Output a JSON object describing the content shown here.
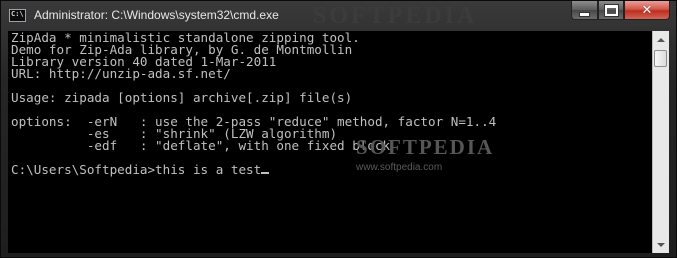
{
  "window": {
    "title": "Administrator: C:\\Windows\\system32\\cmd.exe",
    "icon_text": "C:\\",
    "watermark": "SOFTPEDIA",
    "buttons": {
      "minimize": "minimize-icon",
      "maximize": "maximize-icon",
      "close": "✕"
    }
  },
  "console": {
    "lines": [
      "ZipAda * minimalistic standalone zipping tool.",
      "Demo for Zip-Ada library, by G. de Montmollin",
      "Library version 40 dated 1-Mar-2011",
      "URL: http://unzip-ada.sf.net/",
      "",
      "Usage: zipada [options] archive[.zip] file(s)",
      "",
      "options:  -erN   : use the 2-pass \"reduce\" method, factor N=1..4",
      "          -es    : \"shrink\" (LZW algorithm)",
      "          -edf   : \"deflate\", with one fixed block",
      "",
      "C:\\Users\\Softpedia>this is a test"
    ]
  },
  "overlay": {
    "mark": "SOFTPEDIA",
    "url": "www.softpedia.com"
  },
  "colors": {
    "console_bg": "#000000",
    "console_text": "#c0c0c0",
    "close_button": "#c94a3c"
  }
}
